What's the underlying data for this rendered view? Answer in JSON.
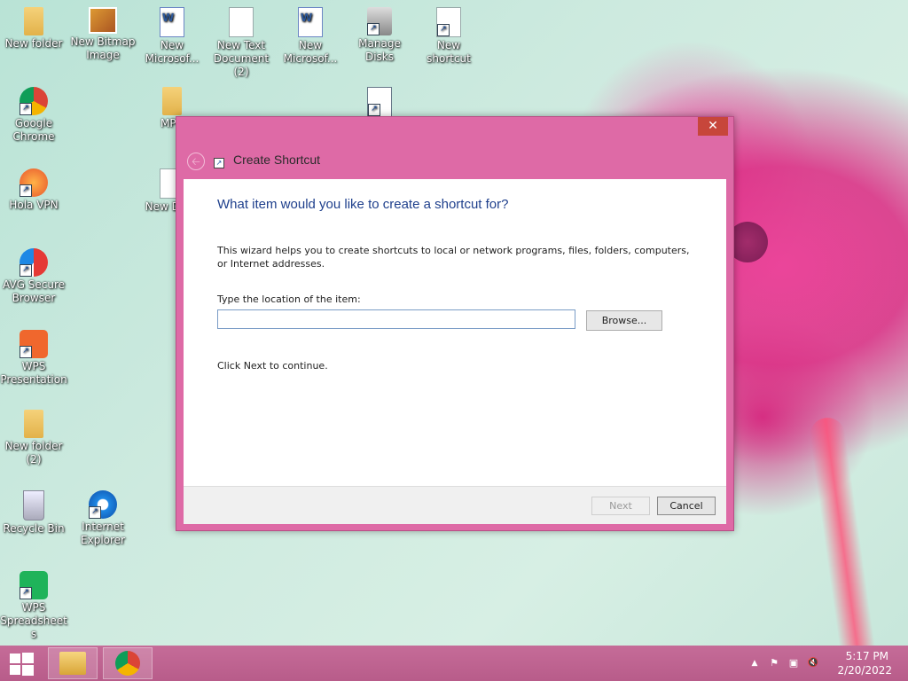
{
  "desktop": {
    "icons": [
      {
        "label": "New folder"
      },
      {
        "label": "New Bitmap Image"
      },
      {
        "label": "New Microsof..."
      },
      {
        "label": "New Text Document (2)"
      },
      {
        "label": "New Microsof..."
      },
      {
        "label": "Manage Disks"
      },
      {
        "label": "New shortcut"
      },
      {
        "label": "Google Chrome"
      },
      {
        "label": "MPR"
      },
      {
        "label": "Hola VPN"
      },
      {
        "label": "New Docu"
      },
      {
        "label": "AVG Secure Browser"
      },
      {
        "label": "WPS Presentation"
      },
      {
        "label": "New folder (2)"
      },
      {
        "label": "Recycle Bin"
      },
      {
        "label": "Internet Explorer"
      },
      {
        "label": "WPS Spreadsheets"
      }
    ]
  },
  "dialog": {
    "title": "Create Shortcut",
    "close_glyph": "✕",
    "back_glyph": "🡠",
    "heading": "What item would you like to create a shortcut for?",
    "description": "This wizard helps you to create shortcuts to local or network programs, files, folders, computers, or Internet addresses.",
    "location_label": "Type the location of the item:",
    "location_value": "",
    "browse_label": "Browse...",
    "continue_text": "Click Next to continue.",
    "next_label": "Next",
    "cancel_label": "Cancel"
  },
  "taskbar": {
    "apps": [
      {
        "name": "File Explorer"
      },
      {
        "name": "Google Chrome"
      }
    ],
    "tray": {
      "show_hidden_glyph": "▲",
      "action_center_glyph": "⚑",
      "network_glyph": "▣",
      "volume_glyph": "🔇"
    },
    "clock": {
      "time": "5:17 PM",
      "date": "2/20/2022"
    }
  },
  "colors": {
    "dialog_frame": "#de6aa6",
    "close_button": "#c7463b",
    "heading_text": "#1e3f8c",
    "taskbar": "#c06594"
  }
}
